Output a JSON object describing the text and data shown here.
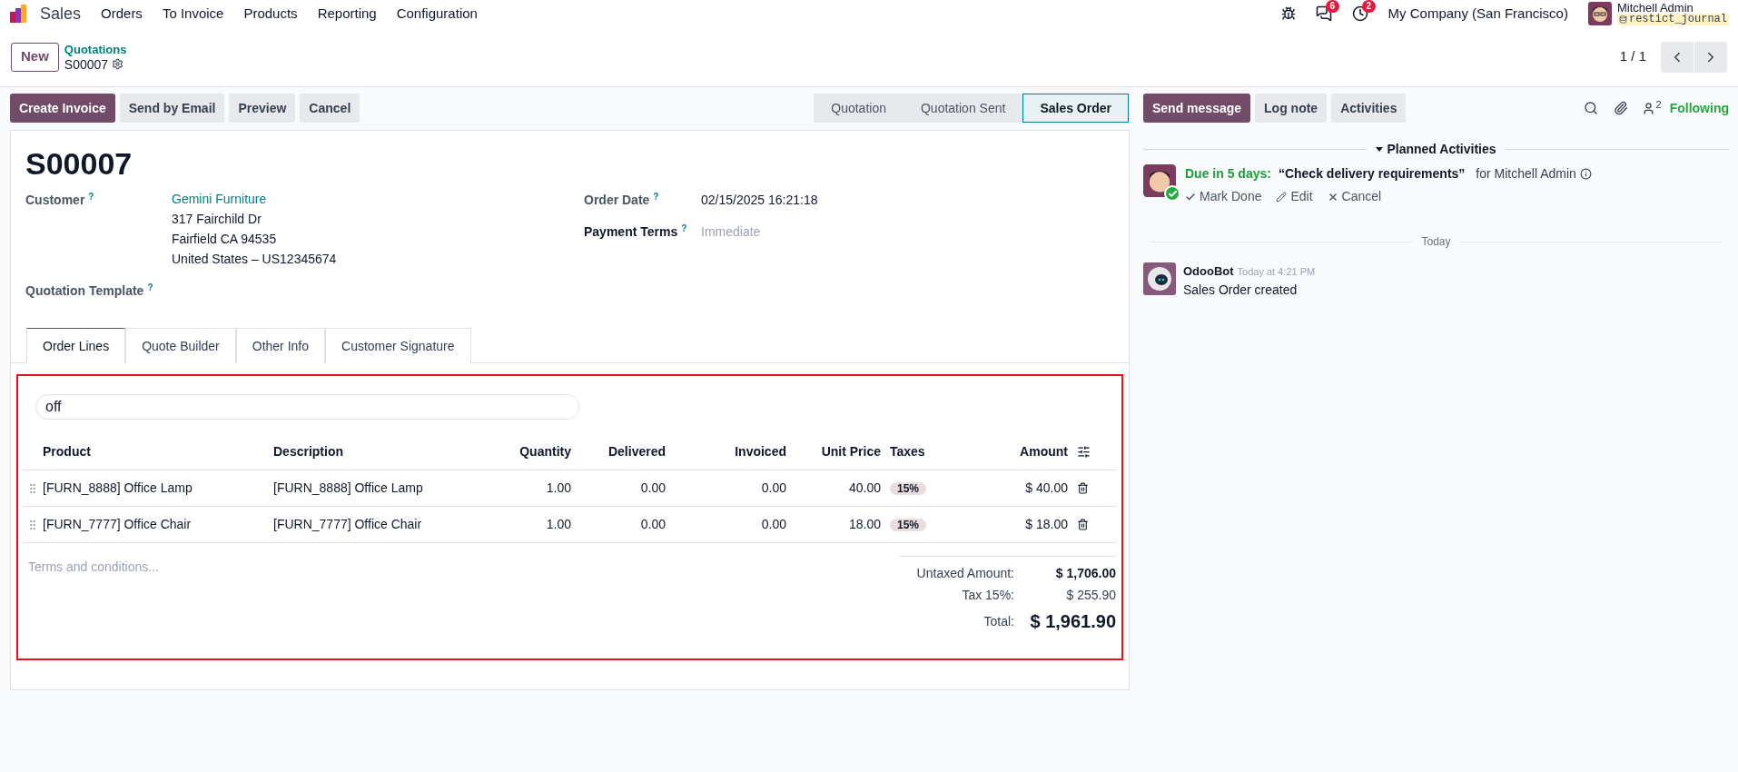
{
  "navbar": {
    "app_name": "Sales",
    "menu": [
      "Orders",
      "To Invoice",
      "Products",
      "Reporting",
      "Configuration"
    ],
    "messages_count": "6",
    "activities_count": "2",
    "company": "My Company (San Francisco)",
    "user_name": "Mitchell Admin",
    "database": "restict_journal"
  },
  "control_panel": {
    "new_button": "New",
    "breadcrumb": "Quotations",
    "record": "S00007",
    "pager": "1 / 1"
  },
  "actions": [
    "Create Invoice",
    "Send by Email",
    "Preview",
    "Cancel"
  ],
  "status_steps": [
    {
      "label": "Quotation",
      "selected": false
    },
    {
      "label": "Quotation Sent",
      "selected": false
    },
    {
      "label": "Sales Order",
      "selected": true
    }
  ],
  "form": {
    "title": "S00007",
    "customer": {
      "label": "Customer",
      "help": "?",
      "name": "Gemini Furniture",
      "address": [
        "317 Fairchild Dr",
        "Fairfield CA 94535",
        "United States – US12345674"
      ]
    },
    "order_date": {
      "label": "Order Date",
      "help": "?",
      "value": "02/15/2025 16:21:18"
    },
    "payment_terms": {
      "label": "Payment Terms",
      "help": "?",
      "placeholder": "Immediate"
    },
    "quotation_template": {
      "label": "Quotation Template",
      "help": "?"
    },
    "tabs": [
      {
        "label": "Order Lines",
        "selected": true
      },
      {
        "label": "Quote Builder",
        "selected": false
      },
      {
        "label": "Other Info",
        "selected": false
      },
      {
        "label": "Customer Signature",
        "selected": false
      }
    ],
    "search_value": "off",
    "columns": [
      "Product",
      "Description",
      "Quantity",
      "Delivered",
      "Invoiced",
      "Unit Price",
      "Taxes",
      "Amount"
    ],
    "rows": [
      {
        "product": "[FURN_8888] Office Lamp",
        "description": "[FURN_8888] Office Lamp",
        "quantity": "1.00",
        "delivered": "0.00",
        "invoiced": "0.00",
        "unit_price": "40.00",
        "tax": "15%",
        "amount": "$ 40.00"
      },
      {
        "product": "[FURN_7777] Office Chair",
        "description": "[FURN_7777] Office Chair",
        "quantity": "1.00",
        "delivered": "0.00",
        "invoiced": "0.00",
        "unit_price": "18.00",
        "tax": "15%",
        "amount": "$ 18.00"
      }
    ],
    "terms_placeholder": "Terms and conditions...",
    "totals": [
      {
        "label": "Untaxed Amount:",
        "value": "$ 1,706.00",
        "kind": "subtotal"
      },
      {
        "label": "Tax 15%:",
        "value": "$ 255.90",
        "kind": "tax"
      },
      {
        "label": "Total:",
        "value": "$ 1,961.90",
        "kind": "total"
      }
    ]
  },
  "chatter": {
    "buttons": [
      {
        "label": "Send message",
        "selected": true
      },
      {
        "label": "Log note",
        "selected": false
      },
      {
        "label": "Activities",
        "selected": false
      }
    ],
    "followers_count": "2",
    "following": "Following",
    "planned_title": "Planned Activities",
    "activity": {
      "due": "Due in 5 days:",
      "summary": "“Check delivery requirements”",
      "assignee": "for Mitchell Admin",
      "actions": [
        "Mark Done",
        "Edit",
        "Cancel"
      ]
    },
    "date_separator": "Today",
    "message": {
      "author": "OdooBot",
      "time": "Today at 4:21 PM",
      "body": "Sales Order created"
    }
  }
}
